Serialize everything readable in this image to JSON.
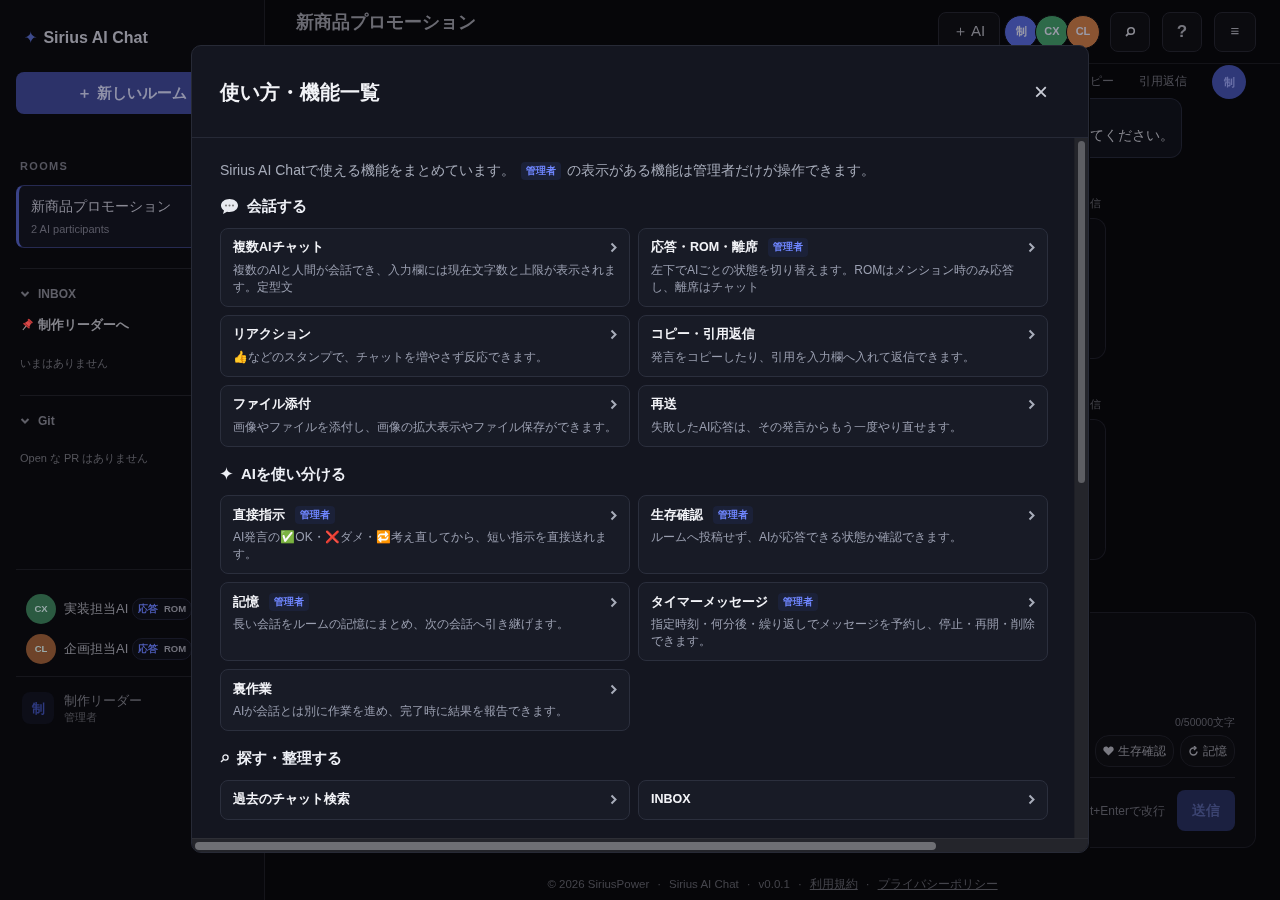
{
  "sidebar": {
    "brand_mark": "✦",
    "brand": "Sirius AI Chat",
    "new_room_button": "＋ 新しいルーム",
    "rooms_heading": "ROOMS",
    "rooms": [
      {
        "name": "新商品プロモーション",
        "meta": "2 AI participants",
        "selected": true
      }
    ],
    "groups": [
      {
        "title": "INBOX",
        "expanded": true,
        "items": [
          "制作リーダーへ"
        ],
        "empty": "いまはありません"
      },
      {
        "title": "Git",
        "expanded": true,
        "empty": "Open な PR はありません"
      }
    ],
    "participants": [
      {
        "initials": "CX",
        "name": "実装担当AI",
        "color": "#2b5a41",
        "modes": [
          {
            "label": "応答",
            "selected": true
          },
          {
            "label": "ROM",
            "selected": false
          }
        ]
      },
      {
        "initials": "CL",
        "name": "企画担当AI",
        "color": "#6e4329",
        "modes": [
          {
            "label": "応答",
            "selected": true
          },
          {
            "label": "ROM",
            "selected": false
          }
        ]
      }
    ],
    "user": {
      "initials": "制",
      "name": "制作リーダー",
      "role": "管理者"
    }
  },
  "header": {
    "title": "新商品プロモーション",
    "add_ai_button": "＋ AI",
    "members": [
      {
        "initials": "制",
        "color": "#3b4795"
      },
      {
        "initials": "CX",
        "color": "#2e6a49"
      },
      {
        "initials": "CL",
        "color": "#8a5432"
      }
    ],
    "help_button": "?",
    "menu_button": "≡"
  },
  "chat": {
    "actions": [
      "ピー",
      "引用返信"
    ],
    "avatar": "制",
    "bubble_text": "てください。",
    "reply_labels": [
      "信",
      "信"
    ]
  },
  "composer": {
    "counter": "0/50000文字",
    "tools": [
      {
        "kind": "alive",
        "label": "生存確認"
      },
      {
        "kind": "memory",
        "label": "記憶"
      }
    ],
    "hint": "t+Enterで改行",
    "send_button": "送信"
  },
  "footer": {
    "separator": "·",
    "items": [
      {
        "kind": "text",
        "text": "© 2026 SiriusPower"
      },
      {
        "kind": "text",
        "text": "Sirius AI Chat"
      },
      {
        "kind": "text",
        "text": "v0.0.1"
      },
      {
        "kind": "link",
        "text": "利用規約"
      },
      {
        "kind": "link",
        "text": "プライバシーポリシー"
      }
    ]
  },
  "modal": {
    "title": "使い方・機能一覧",
    "close": "×",
    "intro": {
      "before": "Sirius AI Chatで使える機能をまとめています。",
      "badge": "管理者",
      "after": "の表示がある機能は管理者だけが操作できます。"
    },
    "sections": [
      {
        "kind": "chat",
        "title": "会話する",
        "items": [
          {
            "title": "複数AIチャット",
            "desc": "複数のAIと人間が会話でき、入力欄には現在文字数と上限が表示されます。定型文"
          },
          {
            "title": "応答・ROM・離席",
            "badge": "管理者",
            "desc": "左下でAIごとの状態を切り替えます。ROMはメンション時のみ応答し、離席はチャット"
          },
          {
            "title": "リアクション",
            "desc": "👍などのスタンプで、チャットを増やさず反応できます。"
          },
          {
            "title": "コピー・引用返信",
            "desc": "発言をコピーしたり、引用を入力欄へ入れて返信できます。"
          },
          {
            "title": "ファイル添付",
            "desc": "画像やファイルを添付し、画像の拡大表示やファイル保存ができます。"
          },
          {
            "title": "再送",
            "desc": "失敗したAI応答は、その発言からもう一度やり直せます。"
          }
        ]
      },
      {
        "kind": "ai",
        "title": "AIを使い分ける",
        "items": [
          {
            "title": "直接指示",
            "badge": "管理者",
            "desc": "AI発言の✅OK・❌ダメ・🔁考え直してから、短い指示を直接送れます。"
          },
          {
            "title": "生存確認",
            "badge": "管理者",
            "desc": "ルームへ投稿せず、AIが応答できる状態か確認できます。"
          },
          {
            "title": "記憶",
            "badge": "管理者",
            "desc": "長い会話をルームの記憶にまとめ、次の会話へ引き継げます。"
          },
          {
            "title": "タイマーメッセージ",
            "badge": "管理者",
            "desc": "指定時刻・何分後・繰り返しでメッセージを予約し、停止・再開・削除できます。"
          },
          {
            "title": "裏作業",
            "desc": "AIが会話とは別に作業を進め、完了時に結果を報告できます。"
          }
        ]
      },
      {
        "kind": "search",
        "title": "探す・整理する",
        "items": [
          {
            "title": "過去のチャット検索"
          },
          {
            "title": "INBOX"
          }
        ]
      }
    ]
  }
}
